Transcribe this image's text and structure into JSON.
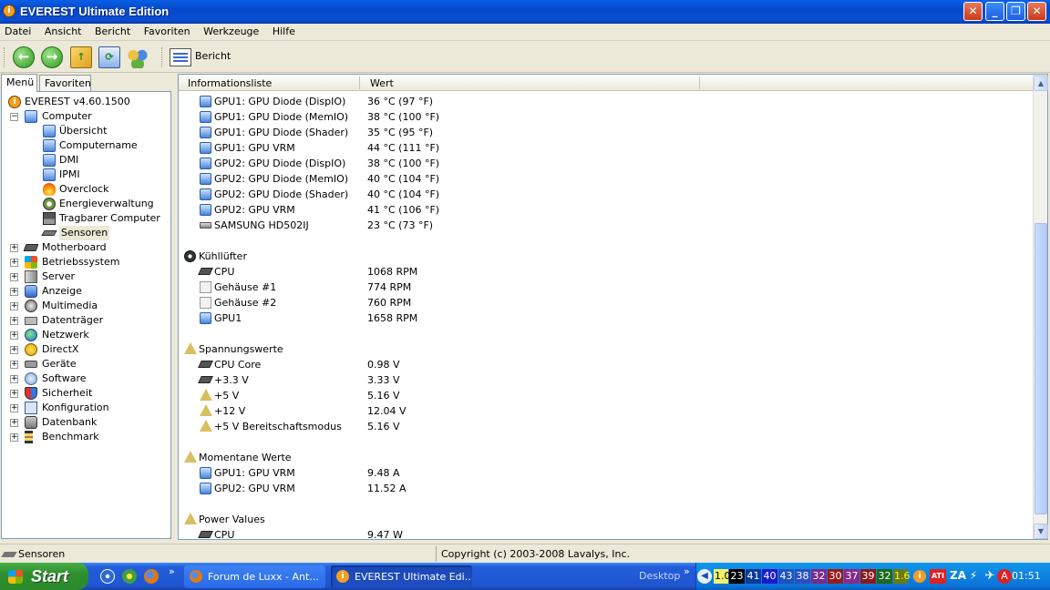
{
  "window": {
    "title": "EVEREST Ultimate Edition"
  },
  "menu": [
    "Datei",
    "Ansicht",
    "Bericht",
    "Favoriten",
    "Werkzeuge",
    "Hilfe"
  ],
  "toolbar": {
    "report_label": "Bericht"
  },
  "left_tabs": [
    "Menü",
    "Favoriten"
  ],
  "tree": [
    {
      "label": "EVEREST v4.60.1500",
      "icon": "info-icon",
      "level": 0,
      "exp": ""
    },
    {
      "label": "Computer",
      "icon": "computer-icon",
      "level": 1,
      "exp": "−"
    },
    {
      "label": "Übersicht",
      "icon": "overview-icon",
      "level": 2,
      "exp": ""
    },
    {
      "label": "Computername",
      "icon": "computer-name-icon",
      "level": 2,
      "exp": ""
    },
    {
      "label": "DMI",
      "icon": "dmi-icon",
      "level": 2,
      "exp": ""
    },
    {
      "label": "IPMI",
      "icon": "ipmi-icon",
      "level": 2,
      "exp": ""
    },
    {
      "label": "Overclock",
      "icon": "fire-icon",
      "level": 2,
      "exp": ""
    },
    {
      "label": "Energieverwaltung",
      "icon": "power-icon",
      "level": 2,
      "exp": ""
    },
    {
      "label": "Tragbarer Computer",
      "icon": "laptop-icon",
      "level": 2,
      "exp": ""
    },
    {
      "label": "Sensoren",
      "icon": "sensor-icon",
      "level": 2,
      "exp": ""
    },
    {
      "label": "Motherboard",
      "icon": "motherboard-icon",
      "level": 1,
      "exp": "+"
    },
    {
      "label": "Betriebssystem",
      "icon": "windows-icon",
      "level": 1,
      "exp": "+"
    },
    {
      "label": "Server",
      "icon": "server-icon",
      "level": 1,
      "exp": "+"
    },
    {
      "label": "Anzeige",
      "icon": "display-icon",
      "level": 1,
      "exp": "+"
    },
    {
      "label": "Multimedia",
      "icon": "multimedia-icon",
      "level": 1,
      "exp": "+"
    },
    {
      "label": "Datenträger",
      "icon": "hard-drive-icon",
      "level": 1,
      "exp": "+"
    },
    {
      "label": "Netzwerk",
      "icon": "network-icon",
      "level": 1,
      "exp": "+"
    },
    {
      "label": "DirectX",
      "icon": "directx-icon",
      "level": 1,
      "exp": "+"
    },
    {
      "label": "Geräte",
      "icon": "devices-icon",
      "level": 1,
      "exp": "+"
    },
    {
      "label": "Software",
      "icon": "software-icon",
      "level": 1,
      "exp": "+"
    },
    {
      "label": "Sicherheit",
      "icon": "shield-icon",
      "level": 1,
      "exp": "+"
    },
    {
      "label": "Konfiguration",
      "icon": "config-icon",
      "level": 1,
      "exp": "+"
    },
    {
      "label": "Datenbank",
      "icon": "database-icon",
      "level": 1,
      "exp": "+"
    },
    {
      "label": "Benchmark",
      "icon": "benchmark-icon",
      "level": 1,
      "exp": "+"
    }
  ],
  "columns": [
    "Informationsliste",
    "Wert"
  ],
  "rows": [
    {
      "type": "item",
      "icon": "gpu-icon",
      "name": "GPU1: GPU Diode (DispIO)",
      "value": "36 °C  (97 °F)"
    },
    {
      "type": "item",
      "icon": "gpu-icon",
      "name": "GPU1: GPU Diode (MemIO)",
      "value": "38 °C  (100 °F)"
    },
    {
      "type": "item",
      "icon": "gpu-icon",
      "name": "GPU1: GPU Diode (Shader)",
      "value": "35 °C  (95 °F)"
    },
    {
      "type": "item",
      "icon": "gpu-icon",
      "name": "GPU1: GPU VRM",
      "value": "44 °C  (111 °F)"
    },
    {
      "type": "item",
      "icon": "gpu-icon",
      "name": "GPU2: GPU Diode (DispIO)",
      "value": "38 °C  (100 °F)"
    },
    {
      "type": "item",
      "icon": "gpu-icon",
      "name": "GPU2: GPU Diode (MemIO)",
      "value": "40 °C  (104 °F)"
    },
    {
      "type": "item",
      "icon": "gpu-icon",
      "name": "GPU2: GPU Diode (Shader)",
      "value": "40 °C  (104 °F)"
    },
    {
      "type": "item",
      "icon": "gpu-icon",
      "name": "GPU2: GPU VRM",
      "value": "41 °C  (106 °F)"
    },
    {
      "type": "item",
      "icon": "hard-drive-icon",
      "name": "SAMSUNG HD502IJ",
      "value": "23 °C  (73 °F)"
    },
    {
      "type": "blank",
      "icon": "",
      "name": "",
      "value": ""
    },
    {
      "type": "section",
      "icon": "fan-icon",
      "name": "Kühllüfter",
      "value": ""
    },
    {
      "type": "item",
      "icon": "cpu-icon",
      "name": "CPU",
      "value": "1068 RPM"
    },
    {
      "type": "item",
      "icon": "case-icon",
      "name": "Gehäuse #1",
      "value": "774 RPM"
    },
    {
      "type": "item",
      "icon": "case-icon",
      "name": "Gehäuse #2",
      "value": "760 RPM"
    },
    {
      "type": "item",
      "icon": "gpu-icon",
      "name": "GPU1",
      "value": "1658 RPM"
    },
    {
      "type": "blank",
      "icon": "",
      "name": "",
      "value": ""
    },
    {
      "type": "section",
      "icon": "warning-icon",
      "name": "Spannungswerte",
      "value": ""
    },
    {
      "type": "item",
      "icon": "cpu-icon",
      "name": "CPU Core",
      "value": "0.98 V"
    },
    {
      "type": "item",
      "icon": "cpu-icon",
      "name": "+3.3 V",
      "value": "3.33 V"
    },
    {
      "type": "item",
      "icon": "warning-icon",
      "name": "+5 V",
      "value": "5.16 V"
    },
    {
      "type": "item",
      "icon": "warning-icon",
      "name": "+12 V",
      "value": "12.04 V"
    },
    {
      "type": "item",
      "icon": "warning-icon",
      "name": "+5 V Bereitschaftsmodus",
      "value": "5.16 V"
    },
    {
      "type": "blank",
      "icon": "",
      "name": "",
      "value": ""
    },
    {
      "type": "section",
      "icon": "warning-icon",
      "name": "Momentane Werte",
      "value": ""
    },
    {
      "type": "item",
      "icon": "gpu-icon",
      "name": "GPU1: GPU VRM",
      "value": "9.48 A"
    },
    {
      "type": "item",
      "icon": "gpu-icon",
      "name": "GPU2: GPU VRM",
      "value": "11.52 A"
    },
    {
      "type": "blank",
      "icon": "",
      "name": "",
      "value": ""
    },
    {
      "type": "section",
      "icon": "warning-icon",
      "name": "Power Values",
      "value": ""
    },
    {
      "type": "item",
      "icon": "cpu-icon",
      "name": "CPU",
      "value": "9.47 W"
    }
  ],
  "status": {
    "left": "Sensoren",
    "right": "Copyright (c) 2003-2008 Lavalys, Inc."
  },
  "taskbar": {
    "start": "Start",
    "buttons": [
      "Forum de Luxx - Ant...",
      "EVEREST Ultimate Edi..."
    ],
    "desktop": "Desktop",
    "tray_values": [
      {
        "text": "1.0",
        "bg": "#f2f26a",
        "fg": "#000"
      },
      {
        "text": "23",
        "bg": "#000000",
        "fg": "#fff"
      },
      {
        "text": "41",
        "bg": "#0a3a9a",
        "fg": "#fff"
      },
      {
        "text": "40",
        "bg": "#1a1acc",
        "fg": "#fff"
      },
      {
        "text": "43",
        "bg": "#1f52c0",
        "fg": "#fff"
      },
      {
        "text": "38",
        "bg": "#2a4fc0",
        "fg": "#fff"
      },
      {
        "text": "32",
        "bg": "#7a2a88",
        "fg": "#fff"
      },
      {
        "text": "30",
        "bg": "#9a1a1a",
        "fg": "#fff"
      },
      {
        "text": "37",
        "bg": "#8a2a8a",
        "fg": "#fff"
      },
      {
        "text": "39",
        "bg": "#8a1a1a",
        "fg": "#fff"
      },
      {
        "text": "32",
        "bg": "#1a6a1a",
        "fg": "#fff"
      },
      {
        "text": "1.6",
        "bg": "#6a7a1a",
        "fg": "#ff0"
      }
    ],
    "clock": "01:51"
  }
}
